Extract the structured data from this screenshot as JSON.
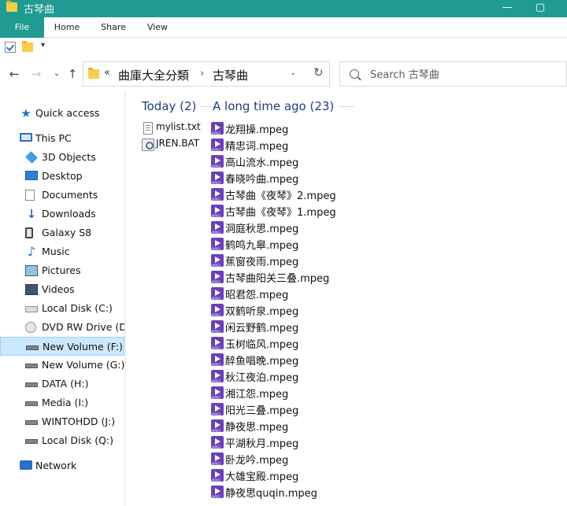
{
  "window": {
    "title": "古琴曲",
    "controls": {
      "minimize": "—",
      "maximize": "▢"
    }
  },
  "ribbon": {
    "tabs": [
      "File",
      "Home",
      "Share",
      "View"
    ]
  },
  "quick_access_toolbar": {
    "dropdown": "▾"
  },
  "navigation": {
    "back": "←",
    "forward": "→",
    "recent": "⌄",
    "up": "↑"
  },
  "address": {
    "overflow": "«",
    "crumbs": [
      "曲庫大全分類",
      "古琴曲"
    ],
    "separator": "›",
    "dropdown": "⌄",
    "refresh": "↻"
  },
  "search": {
    "placeholder": "Search 古琴曲"
  },
  "nav_pane": {
    "items": [
      {
        "label": "Quick access",
        "icon": "star-icon"
      },
      {
        "label": "This PC",
        "icon": "computer-icon"
      },
      {
        "label": "3D Objects",
        "icon": "cube-icon"
      },
      {
        "label": "Desktop",
        "icon": "desktop-icon"
      },
      {
        "label": "Documents",
        "icon": "document-icon"
      },
      {
        "label": "Downloads",
        "icon": "download-icon"
      },
      {
        "label": "Galaxy S8",
        "icon": "phone-icon"
      },
      {
        "label": "Music",
        "icon": "music-icon"
      },
      {
        "label": "Pictures",
        "icon": "picture-icon"
      },
      {
        "label": "Videos",
        "icon": "video-icon"
      },
      {
        "label": "Local Disk (C:)",
        "icon": "disk-icon"
      },
      {
        "label": "DVD RW Drive (D:",
        "icon": "dvd-icon"
      },
      {
        "label": "New Volume (F:)",
        "icon": "drive-icon",
        "selected": true
      },
      {
        "label": "New Volume (G:)",
        "icon": "drive-icon"
      },
      {
        "label": "DATA (H:)",
        "icon": "drive-icon"
      },
      {
        "label": "Media (I:)",
        "icon": "drive-icon"
      },
      {
        "label": "WINTOHDD (J:)",
        "icon": "drive-icon"
      },
      {
        "label": "Local Disk (Q:)",
        "icon": "drive-icon"
      },
      {
        "label": "Network",
        "icon": "network-icon"
      }
    ]
  },
  "groups": [
    {
      "header": "Today (2)",
      "files": [
        {
          "name": "mylist.txt",
          "icon": "text-file-icon"
        },
        {
          "name": "JREN.BAT",
          "icon": "batch-file-icon"
        }
      ]
    },
    {
      "header": "A long time ago (23)",
      "files": [
        {
          "name": "龙翔操.mpeg",
          "icon": "mpeg-file-icon"
        },
        {
          "name": "精忠词.mpeg",
          "icon": "mpeg-file-icon"
        },
        {
          "name": "高山流水.mpeg",
          "icon": "mpeg-file-icon"
        },
        {
          "name": "春晓吟曲.mpeg",
          "icon": "mpeg-file-icon"
        },
        {
          "name": "古琴曲《夜琴》2.mpeg",
          "icon": "mpeg-file-icon"
        },
        {
          "name": "古琴曲《夜琴》1.mpeg",
          "icon": "mpeg-file-icon"
        },
        {
          "name": "洞庭秋思.mpeg",
          "icon": "mpeg-file-icon"
        },
        {
          "name": "鹤鸣九皋.mpeg",
          "icon": "mpeg-file-icon"
        },
        {
          "name": "蕉窗夜雨.mpeg",
          "icon": "mpeg-file-icon"
        },
        {
          "name": "古琴曲阳关三叠.mpeg",
          "icon": "mpeg-file-icon"
        },
        {
          "name": "昭君怨.mpeg",
          "icon": "mpeg-file-icon"
        },
        {
          "name": "双鹤听泉.mpeg",
          "icon": "mpeg-file-icon"
        },
        {
          "name": "闲云野鹤.mpeg",
          "icon": "mpeg-file-icon"
        },
        {
          "name": "玉树临风.mpeg",
          "icon": "mpeg-file-icon"
        },
        {
          "name": "醉鱼唱晚.mpeg",
          "icon": "mpeg-file-icon"
        },
        {
          "name": "秋江夜泊.mpeg",
          "icon": "mpeg-file-icon"
        },
        {
          "name": "湘江怨.mpeg",
          "icon": "mpeg-file-icon"
        },
        {
          "name": "阳光三叠.mpeg",
          "icon": "mpeg-file-icon"
        },
        {
          "name": "静夜思.mpeg",
          "icon": "mpeg-file-icon"
        },
        {
          "name": "平湖秋月.mpeg",
          "icon": "mpeg-file-icon"
        },
        {
          "name": "卧龙吟.mpeg",
          "icon": "mpeg-file-icon"
        },
        {
          "name": "大雄宝殿.mpeg",
          "icon": "mpeg-file-icon"
        },
        {
          "name": "静夜思quqin.mpeg",
          "icon": "mpeg-file-icon"
        }
      ]
    }
  ],
  "colors": {
    "title_bar": "#1f9b91",
    "selection": "#cce8ff",
    "group_header": "#1e3f82",
    "mpeg_icon": "#6a3fbf",
    "folder": "#f8cd4a"
  }
}
